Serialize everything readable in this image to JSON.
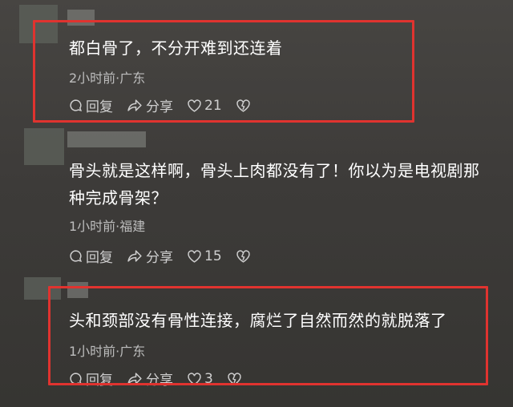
{
  "comments": [
    {
      "text": "都白骨了，不分开难到还连着",
      "meta": "2小时前·广东",
      "reply": "回复",
      "share": "分享",
      "likes": "21"
    },
    {
      "text_line1": "骨头就是这样啊，骨头上肉都没有了！你以为是电视剧那",
      "text_line2": "种完成骨架？",
      "meta": "1小时前·福建",
      "reply": "回复",
      "share": "分享",
      "likes": "15"
    },
    {
      "text": "头和颈部没有骨性连接，腐烂了自然而然的就脱落了",
      "meta": "1小时前·广东",
      "reply": "回复",
      "share": "分享",
      "likes": "3"
    }
  ],
  "icons": [
    "reply-icon",
    "share-icon",
    "heart-icon",
    "dislike-icon"
  ],
  "colors": {
    "highlight": "#e0332f",
    "text": "#ffffff",
    "meta": "#bdbdbd"
  }
}
